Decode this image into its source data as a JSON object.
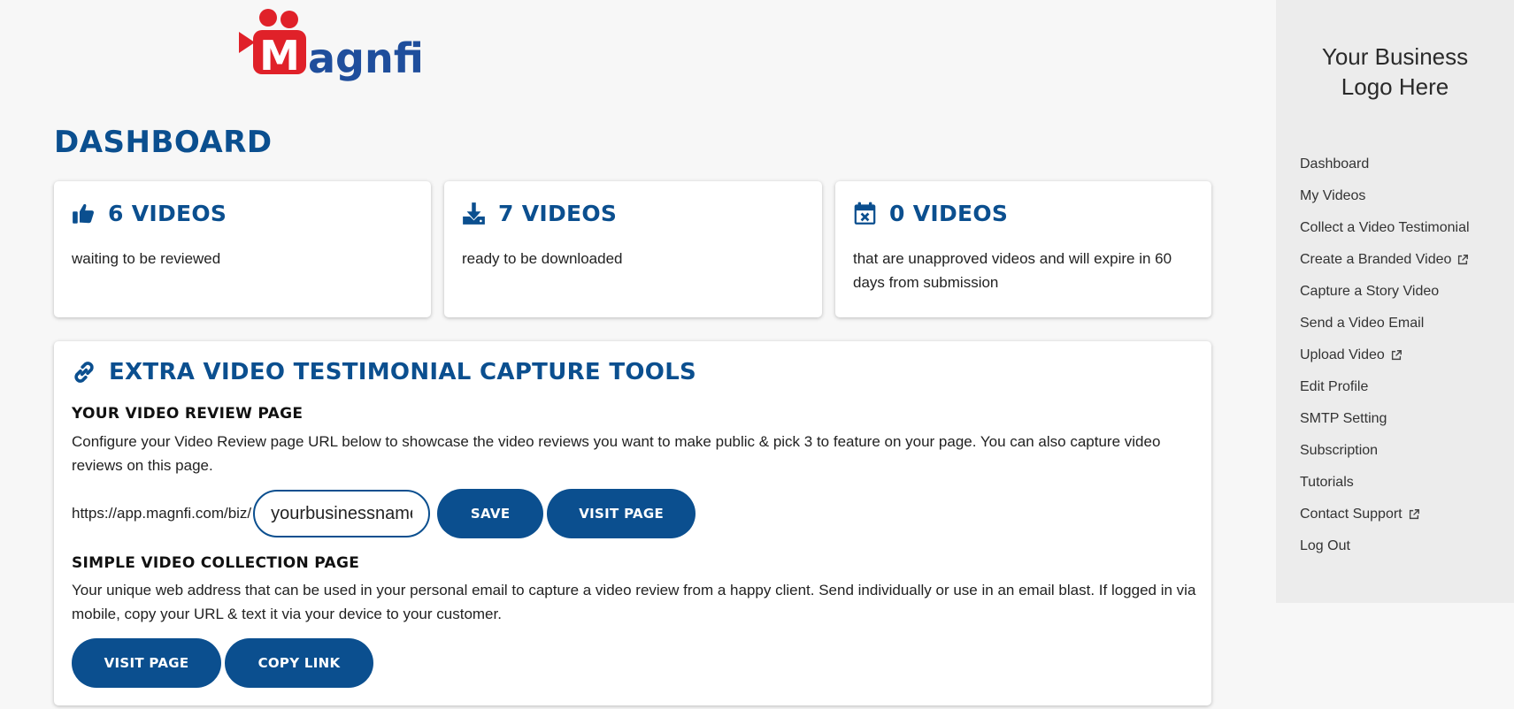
{
  "brand": {
    "logo_text": "Magnfi",
    "colors": {
      "primary": "#0b4f8f",
      "logo_red": "#e02129",
      "logo_blue": "#1f4e9c"
    }
  },
  "page": {
    "title": "DASHBOARD"
  },
  "stats": [
    {
      "icon": "thumbs-up-icon",
      "value": "6 VIDEOS",
      "description": "waiting to be reviewed"
    },
    {
      "icon": "download-icon",
      "value": "7 VIDEOS",
      "description": "ready to be downloaded"
    },
    {
      "icon": "calendar-x-icon",
      "value": "0 VIDEOS",
      "description": "that are unapproved videos and will expire in 60 days from submission"
    }
  ],
  "tools": {
    "icon": "link-icon",
    "title": "EXTRA VIDEO TESTIMONIAL CAPTURE TOOLS",
    "review_page": {
      "title": "YOUR VIDEO REVIEW PAGE",
      "description": "Configure your Video Review page URL below to showcase the video reviews you want to make public & pick 3 to feature on your page. You can also capture video reviews on this page.",
      "url_prefix": "https://app.magnfi.com/biz/",
      "slug_value": "yourbusinessname",
      "save_label": "SAVE",
      "visit_label": "VISIT PAGE"
    },
    "collection_page": {
      "title": "SIMPLE VIDEO COLLECTION PAGE",
      "description": "Your unique web address that can be used in your personal email to capture a video review from a happy client. Send individually or use in an email blast. If logged in via mobile, copy your URL & text it via your device to your customer.",
      "visit_label": "VISIT PAGE",
      "copy_label": "COPY LINK"
    }
  },
  "sidebar": {
    "logo_placeholder_line1": "Your Business",
    "logo_placeholder_line2": "Logo Here",
    "items": [
      {
        "label": "Dashboard",
        "external": false
      },
      {
        "label": "My Videos",
        "external": false
      },
      {
        "label": "Collect a Video Testimonial",
        "external": false
      },
      {
        "label": "Create a Branded Video",
        "external": true
      },
      {
        "label": "Capture a Story Video",
        "external": false
      },
      {
        "label": "Send a Video Email",
        "external": false
      },
      {
        "label": "Upload Video",
        "external": true
      },
      {
        "label": "Edit Profile",
        "external": false
      },
      {
        "label": "SMTP Setting",
        "external": false
      },
      {
        "label": "Subscription",
        "external": false
      },
      {
        "label": "Tutorials",
        "external": false
      },
      {
        "label": "Contact Support",
        "external": true
      },
      {
        "label": "Log Out",
        "external": false
      }
    ]
  }
}
